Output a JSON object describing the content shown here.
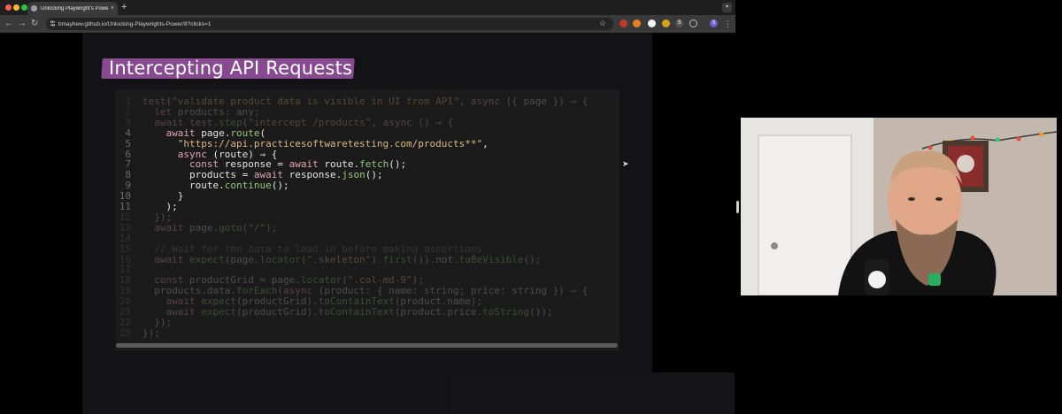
{
  "browser": {
    "tab_title": "Unlocking Playwright's Power",
    "new_tab": "+",
    "tab_close": "×",
    "url": "bmayhew.github.io/Unlocking-Playwrights-Power/8?clicks=1",
    "profile_initial": "S",
    "colors": {
      "tabbar": "#1f1f1f",
      "toolbar": "#3a3a3a",
      "omnibox": "#242424"
    }
  },
  "slide": {
    "title": "Intercepting API Requests",
    "colors": {
      "title_highlight": "#8d4c96",
      "background": "#131316",
      "code_bg": "#1b1b1b"
    }
  },
  "code_lines": [
    {
      "n": "1",
      "text": "test(\"validate product data is visible in UI from API\", async ({ page }) ⇒ {",
      "dim": true
    },
    {
      "n": "2",
      "text": "  let products: any;",
      "dim": true
    },
    {
      "n": "3",
      "text": "  await test.step(\"intercept /products\", async () ⇒ {",
      "dim": true
    },
    {
      "n": "4",
      "text": "    await page.route(",
      "dim": false
    },
    {
      "n": "5",
      "text": "      \"https://api.practicesoftwaretesting.com/products**\",",
      "dim": false
    },
    {
      "n": "6",
      "text": "      async (route) ⇒ {",
      "dim": false
    },
    {
      "n": "7",
      "text": "        const response = await route.fetch();",
      "dim": false
    },
    {
      "n": "8",
      "text": "        products = await response.json();",
      "dim": false
    },
    {
      "n": "9",
      "text": "        route.continue();",
      "dim": false
    },
    {
      "n": "10",
      "text": "      }",
      "dim": false
    },
    {
      "n": "11",
      "text": "    );",
      "dim": false
    },
    {
      "n": "12",
      "text": "  });",
      "dim": true
    },
    {
      "n": "13",
      "text": "  await page.goto(\"/\");",
      "dim": true
    },
    {
      "n": "14",
      "text": "",
      "dim": true
    },
    {
      "n": "15",
      "text": "  // Wait for the data to load in before making assertions",
      "dim": true
    },
    {
      "n": "16",
      "text": "  await expect(page.locator(\".skeleton\").first()).not.toBeVisible();",
      "dim": true
    },
    {
      "n": "17",
      "text": "",
      "dim": true
    },
    {
      "n": "18",
      "text": "  const productGrid = page.locator(\".col-md-9\");",
      "dim": true
    },
    {
      "n": "19",
      "text": "  products.data.forEach(async (product: { name: string; price: string }) ⇒ {",
      "dim": true
    },
    {
      "n": "20",
      "text": "    await expect(productGrid).toContainText(product.name);",
      "dim": true
    },
    {
      "n": "21",
      "text": "    await expect(productGrid).toContainText(product.price.toString());",
      "dim": true
    },
    {
      "n": "22",
      "text": "  });",
      "dim": true
    },
    {
      "n": "23",
      "text": "});",
      "dim": true
    }
  ],
  "icons": [
    "back-icon",
    "forward-icon",
    "reload-icon",
    "tune-icon",
    "star-icon",
    "extension-icon",
    "profile-icon",
    "menu-icon",
    "cursor-icon"
  ]
}
